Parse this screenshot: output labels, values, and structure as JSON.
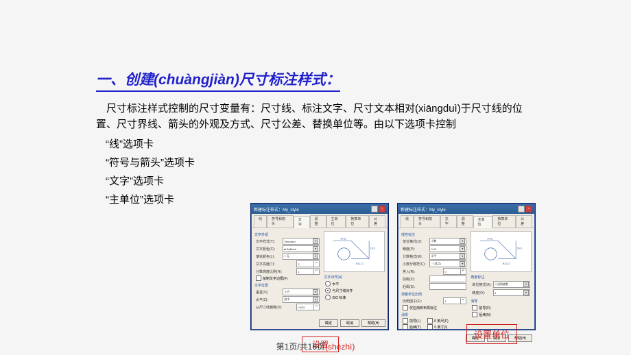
{
  "title": "一、创建(chuàngjiàn)尺寸标注样式：",
  "paragraph": "尺寸标注样式控制的尺寸变量有：尺寸线、标注文字、尺寸文本相对(xiāngduì)于尺寸线的位置、尺寸界线、箭头的外观及方式、尺寸公差、替换单位等。由以下选项卡控制",
  "tabs": {
    "line": "“线”选项卡",
    "symbol": "“符号与箭头”选项卡",
    "text": "“文字”选项卡",
    "unit": "“主单位”选项卡"
  },
  "dialog": {
    "title": "新建标注样式：My_style",
    "tabs": [
      "线",
      "符号和箭头",
      "文字",
      "调整",
      "主单位",
      "换算单位",
      "公差"
    ],
    "active_text_tab": "文字",
    "active_unit_tab": "主单位",
    "text_panel": {
      "appearance": "文字外观",
      "style_label": "文字样式(Y):",
      "style_value": "Standard",
      "color_label": "文字颜色(C):",
      "color_value": "■ ByBlock",
      "fill_label": "填充颜色(L):",
      "fill_value": "□ 无",
      "height_label": "文字高度(T):",
      "height_value": "3",
      "frac_label": "分数高度比例(H):",
      "frac_value": "1",
      "frame_label": "绘制文字边框(F)",
      "position": "文字位置",
      "vert_label": "垂直(V):",
      "vert_value": "上方",
      "horiz_label": "水平(Z):",
      "horiz_value": "居中",
      "offset_label": "从尺寸线偏移(O):",
      "offset_value": "0.625",
      "align": "文字对齐(A)",
      "align_horizontal": "水平",
      "align_aligned": "与尺寸线对齐",
      "align_iso": "ISO 标准"
    },
    "unit_panel": {
      "linear": "线性标注",
      "format_label": "单位格式(U):",
      "format_value": "小数",
      "precision_label": "精度(P):",
      "precision_value": "0.00",
      "frac_label": "分数格式(M):",
      "frac_value": "水平",
      "sep_label": "小数分隔符(C):",
      "sep_value": "'.' (逗点)",
      "round_label": "舍入(R):",
      "round_value": "0",
      "prefix_label": "前缀(X):",
      "suffix_label": "后缀(S):",
      "scale": "测量单位比例",
      "scale_label": "比例因子(E):",
      "scale_value": "1",
      "layout_only": "仅应用到布局标注",
      "zero": "消零",
      "leading": "前导(L)",
      "trailing": "后续(T)",
      "feet": "0 英尺(F)",
      "inches": "0 英寸(I)",
      "angular": "角度标注",
      "ang_format_label": "单位格式(A):",
      "ang_format_value": "十进制度数",
      "ang_precision_label": "精度(O):",
      "ang_precision_value": "0",
      "ang_zero": "消零",
      "ang_leading": "前导(D)",
      "ang_trailing": "后续(N)"
    },
    "buttons": {
      "ok": "确定",
      "cancel": "取消",
      "help": "帮助(H)"
    }
  },
  "captions": {
    "text": "设置",
    "text2": "(shèzhì)",
    "unit": "设置单位"
  },
  "footer": "第1页/共16页"
}
